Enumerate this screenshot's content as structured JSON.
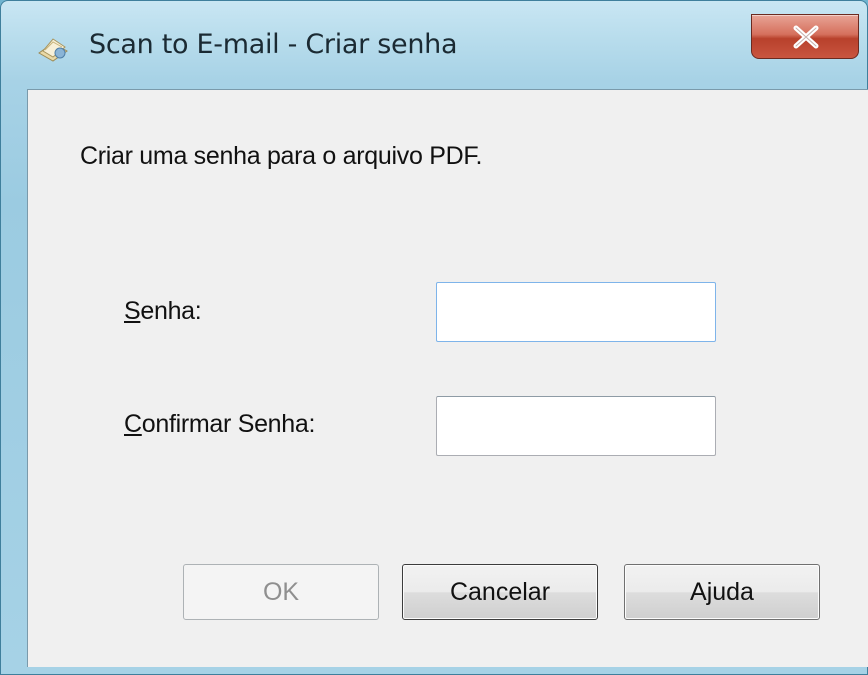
{
  "window": {
    "title": "Scan to E-mail - Criar senha",
    "icon": "scanner-envelope-icon",
    "close_icon": "close-icon",
    "close_color": "#c9553f"
  },
  "dialog": {
    "instruction": "Criar uma senha para o arquivo PDF.",
    "fields": {
      "password": {
        "label_mnemonic": "S",
        "label_rest": "enha:",
        "value": ""
      },
      "confirm": {
        "label_mnemonic": "C",
        "label_rest": "onfirmar Senha:",
        "value": ""
      }
    },
    "buttons": {
      "ok": "OK",
      "ok_enabled": false,
      "cancel": "Cancelar",
      "help": "Ajuda"
    }
  }
}
